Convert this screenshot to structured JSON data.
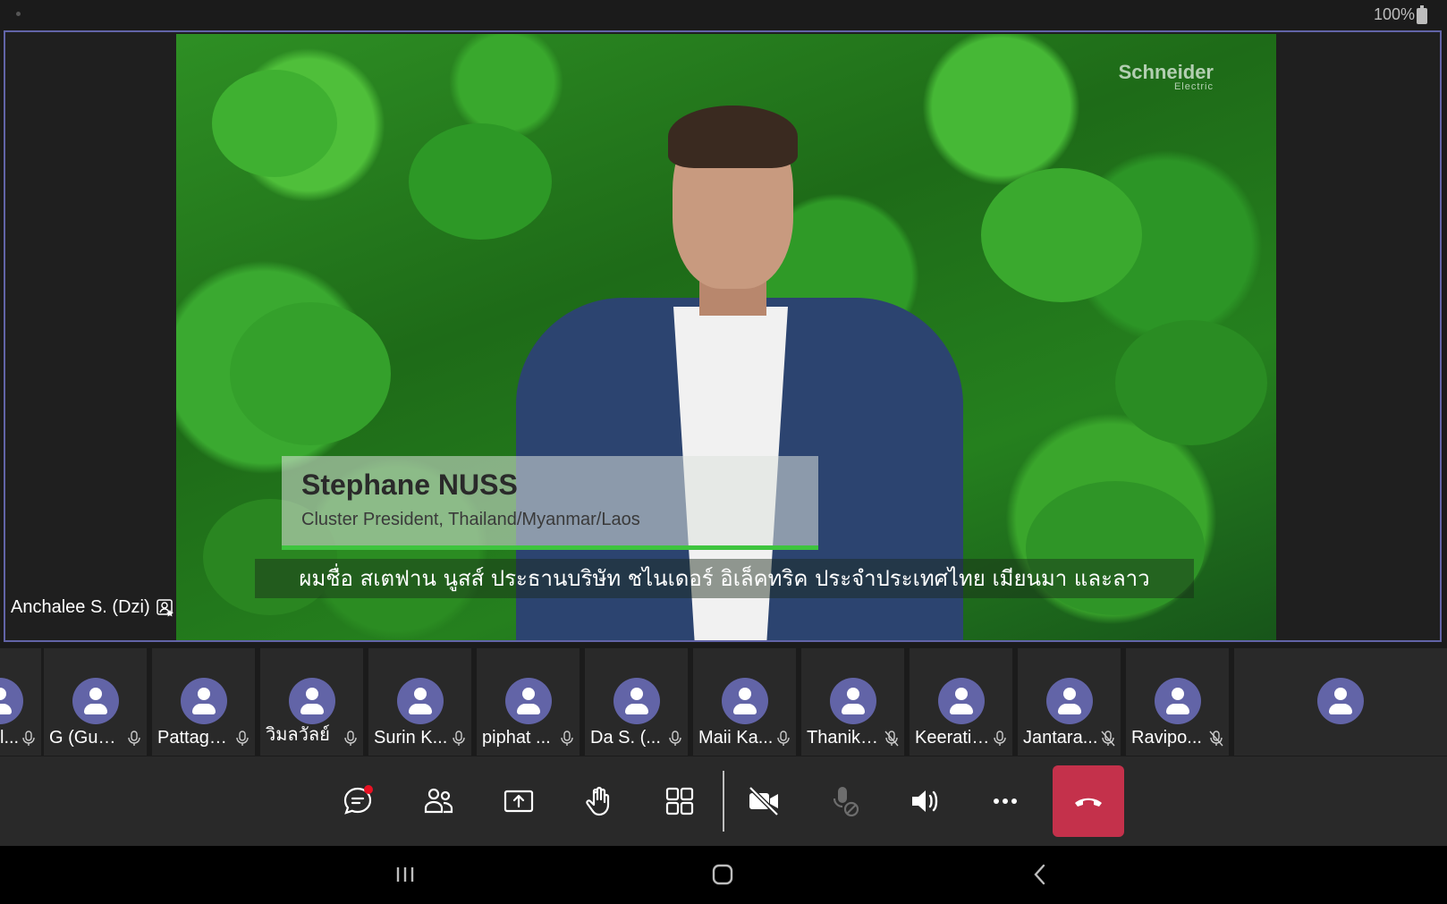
{
  "status_bar": {
    "battery": "100%"
  },
  "stage": {
    "brand": "Schneider",
    "brand_sub": "Electric",
    "lower_third_name": "Stephane NUSS",
    "lower_third_role": "Cluster President, Thailand/Myanmar/Laos",
    "subtitle": "ผมชื่อ สเตฟาน นูสส์ ประธานบริษัท ชไนเดอร์ อิเล็คทริค ประจำประเทศไทย เมียนมา และลาว",
    "presenter_label": "Anchalee S. (Dzi)"
  },
  "participants": [
    {
      "name": "l...",
      "muted": false
    },
    {
      "name": "G (Guest)",
      "muted": false
    },
    {
      "name": "Pattaga...",
      "muted": false
    },
    {
      "name": "วิมลวัลย์",
      "muted": false
    },
    {
      "name": "Surin K...",
      "muted": false
    },
    {
      "name": "piphat ...",
      "muted": false
    },
    {
      "name": "Da S. (...",
      "muted": false
    },
    {
      "name": "Maii Ka...",
      "muted": false
    },
    {
      "name": "Thanika...",
      "muted": true
    },
    {
      "name": "Keerati ...",
      "muted": false
    },
    {
      "name": "Jantara...",
      "muted": true
    },
    {
      "name": "Ravipo...",
      "muted": true
    },
    {
      "name": "",
      "muted": false
    }
  ],
  "call_controls": [
    {
      "name": "chat-button",
      "icon": "chat-icon",
      "badge": true
    },
    {
      "name": "participants-button",
      "icon": "people-icon"
    },
    {
      "name": "share-button",
      "icon": "share-screen-icon"
    },
    {
      "name": "raise-hand-button",
      "icon": "hand-icon"
    },
    {
      "name": "view-button",
      "icon": "grid-icon"
    },
    {
      "name": "camera-button",
      "icon": "camera-off-icon"
    },
    {
      "name": "mic-button",
      "icon": "mic-disabled-icon"
    },
    {
      "name": "speaker-button",
      "icon": "speaker-icon"
    },
    {
      "name": "more-button",
      "icon": "more-icon"
    },
    {
      "name": "hangup-button",
      "icon": "hangup-icon"
    }
  ],
  "colors": {
    "accent": "#6264a7",
    "hangup": "#c4314b",
    "badge": "#e81123"
  }
}
